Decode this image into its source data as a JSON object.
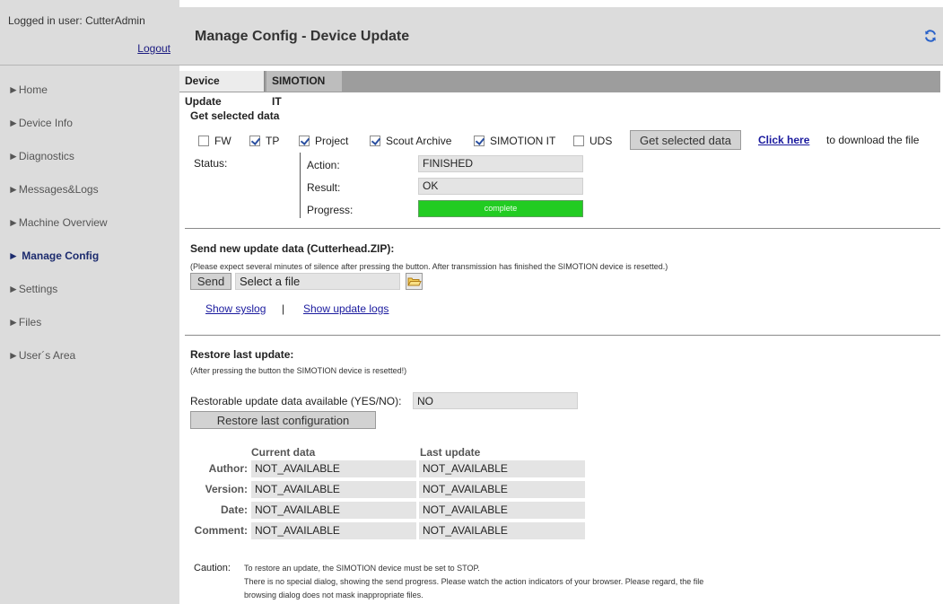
{
  "login": {
    "user_text": "Logged in user: CutterAdmin",
    "logout": "Logout"
  },
  "nav": [
    {
      "label": "►Home"
    },
    {
      "label": "►Device Info"
    },
    {
      "label": "►Diagnostics"
    },
    {
      "label": "►Messages&Logs"
    },
    {
      "label": "►Machine Overview"
    },
    {
      "label": "► Manage Config",
      "active": true
    },
    {
      "label": "►Settings"
    },
    {
      "label": "►Files"
    },
    {
      "label": "►User´s Area"
    }
  ],
  "header": {
    "title": "Manage Config - Device Update",
    "refresh_icon": "refresh-icon"
  },
  "tabs": [
    {
      "label": "Device Update"
    },
    {
      "label": "SIMOTION IT"
    }
  ],
  "get_data": {
    "title": "Get selected data",
    "checkboxes": [
      {
        "label": "FW",
        "checked": false
      },
      {
        "label": "TP",
        "checked": true
      },
      {
        "label": "Project",
        "checked": true
      },
      {
        "label": "Scout Archive",
        "checked": true
      },
      {
        "label": "SIMOTION IT",
        "checked": true
      },
      {
        "label": "UDS",
        "checked": false
      }
    ],
    "button": "Get selected data",
    "link": "Click here",
    "link_suffix": "to download the file"
  },
  "status": {
    "label": "Status:",
    "action_label": "Action:",
    "action_value": "FINISHED",
    "result_label": "Result:",
    "result_value": "OK",
    "progress_label": "Progress:",
    "progress_text": "complete",
    "progress_fraction": 1.0,
    "progress_color": "#22cc22"
  },
  "send": {
    "title": "Send new update data (Cutterhead.ZIP):",
    "note": "(Please expect several minutes of silence after pressing the button. After transmission has finished the SIMOTION device is resetted.)",
    "button": "Send",
    "file_placeholder": "Select a file",
    "show_syslog": "Show syslog",
    "separator": "|",
    "show_update_logs": "Show update logs"
  },
  "restore": {
    "title": "Restore last update:",
    "note": "(After pressing the button the SIMOTION device is resetted!)",
    "available_label": "Restorable update data available (YES/NO):",
    "available_value": "NO",
    "button": "Restore last configuration"
  },
  "compare": {
    "headers": [
      "Current data",
      "Last update"
    ],
    "rows": [
      {
        "label": "Author:",
        "current": "NOT_AVAILABLE",
        "last": "NOT_AVAILABLE"
      },
      {
        "label": "Version:",
        "current": "NOT_AVAILABLE",
        "last": "NOT_AVAILABLE"
      },
      {
        "label": "Date:",
        "current": "NOT_AVAILABLE",
        "last": "NOT_AVAILABLE"
      },
      {
        "label": "Comment:",
        "current": "NOT_AVAILABLE",
        "last": "NOT_AVAILABLE"
      }
    ]
  },
  "caution": {
    "label": "Caution:",
    "lines": [
      "To restore an update, the SIMOTION device must be set to STOP.",
      "There is no special dialog, showing the send progress. Please watch the action indicators of your browser. Please regard, the file",
      "browsing dialog does not mask inappropriate files."
    ]
  }
}
